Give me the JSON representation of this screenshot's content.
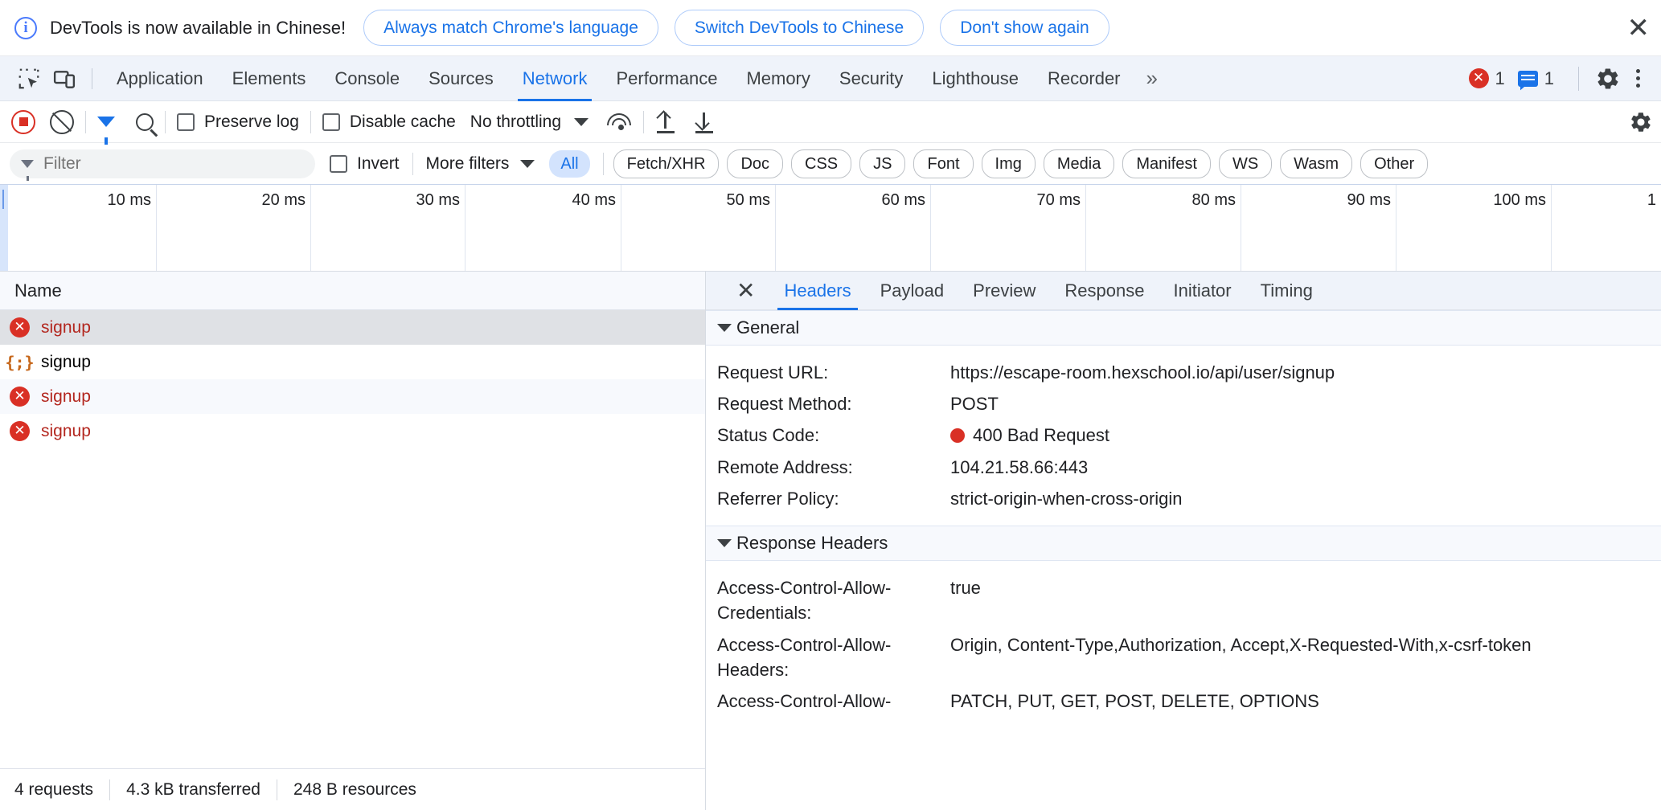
{
  "infobar": {
    "icon": "info-icon",
    "message": "DevTools is now available in Chinese!",
    "buttons": [
      "Always match Chrome's language",
      "Switch DevTools to Chinese",
      "Don't show again"
    ],
    "close": "✕"
  },
  "tabbar": {
    "inspect_icon": "inspect-element-icon",
    "device_icon": "device-toolbar-icon",
    "tabs": [
      {
        "label": "Application",
        "active": false
      },
      {
        "label": "Elements",
        "active": false
      },
      {
        "label": "Console",
        "active": false
      },
      {
        "label": "Sources",
        "active": false
      },
      {
        "label": "Network",
        "active": true
      },
      {
        "label": "Performance",
        "active": false
      },
      {
        "label": "Memory",
        "active": false
      },
      {
        "label": "Security",
        "active": false
      },
      {
        "label": "Lighthouse",
        "active": false
      },
      {
        "label": "Recorder",
        "active": false
      }
    ],
    "more_tabs": "»",
    "error_count": "1",
    "message_count": "1",
    "settings_icon": "gear-icon",
    "menu_icon": "kebab-menu-icon",
    "accent": "#1a73e8",
    "error_color": "#d93025"
  },
  "net_toolbar": {
    "record_label": "record-button",
    "clear_label": "clear-button",
    "filter_icon": "filter-funnel-icon",
    "search_icon": "search-icon",
    "preserve_log": "Preserve log",
    "preserve_log_checked": false,
    "disable_cache": "Disable cache",
    "disable_cache_checked": false,
    "throttling": "No throttling",
    "network_conditions_icon": "network-conditions-icon",
    "import_icon": "import-har-icon",
    "export_icon": "export-har-icon",
    "far_icon": "network-settings-icon"
  },
  "filterbar": {
    "filter_placeholder": "Filter",
    "filter_value": "",
    "invert": "Invert",
    "invert_checked": false,
    "more_filters": "More filters",
    "types": [
      {
        "label": "All",
        "active": true
      },
      {
        "label": "Fetch/XHR",
        "active": false
      },
      {
        "label": "Doc",
        "active": false
      },
      {
        "label": "CSS",
        "active": false
      },
      {
        "label": "JS",
        "active": false
      },
      {
        "label": "Font",
        "active": false
      },
      {
        "label": "Img",
        "active": false
      },
      {
        "label": "Media",
        "active": false
      },
      {
        "label": "Manifest",
        "active": false
      },
      {
        "label": "WS",
        "active": false
      },
      {
        "label": "Wasm",
        "active": false
      },
      {
        "label": "Other",
        "active": false
      }
    ]
  },
  "overview": {
    "ticks": [
      "10 ms",
      "20 ms",
      "30 ms",
      "40 ms",
      "50 ms",
      "60 ms",
      "70 ms",
      "80 ms",
      "90 ms",
      "100 ms",
      "1"
    ]
  },
  "requests": {
    "column_header": "Name",
    "rows": [
      {
        "name": "signup",
        "status": "error",
        "icon": "error-circle-icon",
        "selected": true
      },
      {
        "name": "signup",
        "status": "json",
        "icon": "json-braces-icon",
        "selected": false
      },
      {
        "name": "signup",
        "status": "error",
        "icon": "error-circle-icon",
        "selected": false
      },
      {
        "name": "signup",
        "status": "error",
        "icon": "error-circle-icon",
        "selected": false
      }
    ]
  },
  "statusbar": {
    "requests": "4 requests",
    "transferred": "4.3 kB transferred",
    "resources": "248 B resources"
  },
  "details": {
    "close": "✕",
    "tabs": [
      {
        "label": "Headers",
        "active": true
      },
      {
        "label": "Payload",
        "active": false
      },
      {
        "label": "Preview",
        "active": false
      },
      {
        "label": "Response",
        "active": false
      },
      {
        "label": "Initiator",
        "active": false
      },
      {
        "label": "Timing",
        "active": false
      }
    ],
    "general": {
      "title": "General",
      "rows": [
        {
          "key": "Request URL:",
          "value": "https://escape-room.hexschool.io/api/user/signup",
          "dot": false
        },
        {
          "key": "Request Method:",
          "value": "POST",
          "dot": false
        },
        {
          "key": "Status Code:",
          "value": "400 Bad Request",
          "dot": true
        },
        {
          "key": "Remote Address:",
          "value": "104.21.58.66:443",
          "dot": false
        },
        {
          "key": "Referrer Policy:",
          "value": "strict-origin-when-cross-origin",
          "dot": false
        }
      ]
    },
    "response_headers": {
      "title": "Response Headers",
      "rows": [
        {
          "key": "Access-Control-Allow-Credentials:",
          "value": "true"
        },
        {
          "key": "Access-Control-Allow-Headers:",
          "value": "Origin, Content-Type,Authorization, Accept,X-Requested-With,x-csrf-token"
        },
        {
          "key": "Access-Control-Allow-",
          "value": "PATCH, PUT, GET, POST, DELETE, OPTIONS"
        }
      ]
    }
  }
}
